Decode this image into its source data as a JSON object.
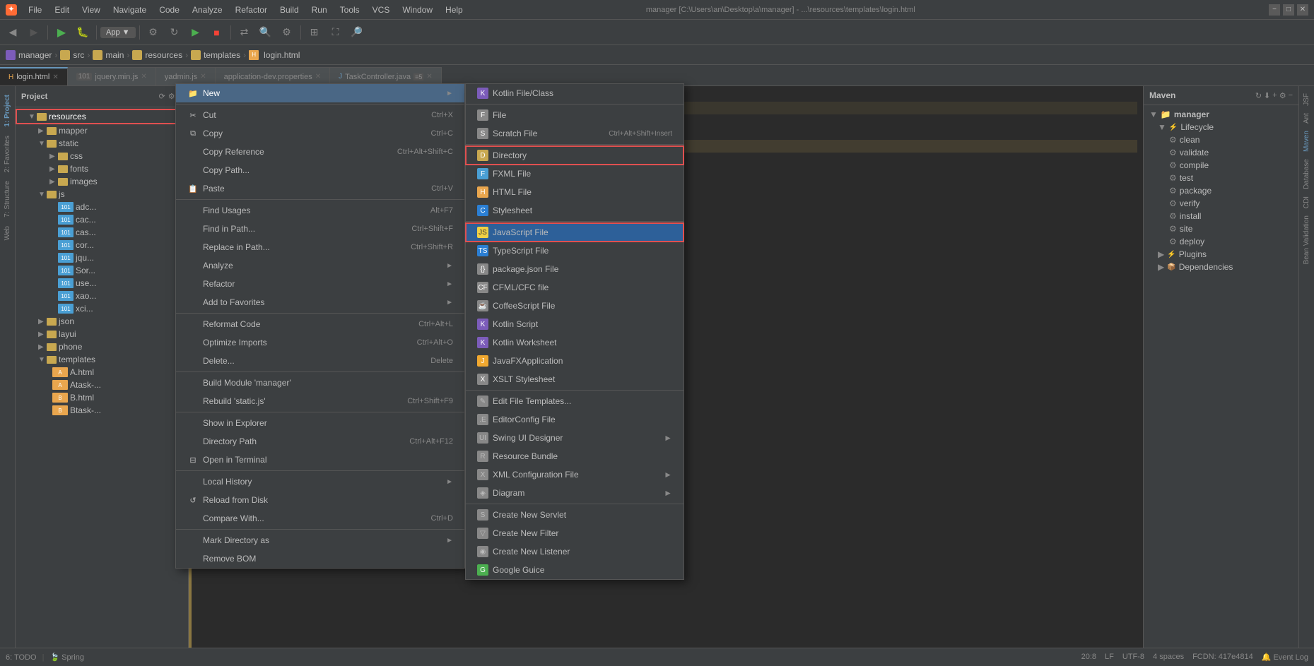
{
  "app": {
    "title": "manager",
    "path": "C:\\Users\\an\\Desktop\\a\\manager",
    "subtitle": "...\\resources\\templates\\login.html",
    "logo": "✦"
  },
  "menubar": {
    "items": [
      "File",
      "Edit",
      "View",
      "Navigate",
      "Code",
      "Analyze",
      "Refactor",
      "Build",
      "Run",
      "Tools",
      "VCS",
      "Window",
      "Help"
    ]
  },
  "breadcrumb": {
    "items": [
      "manager",
      "src",
      "main",
      "resources",
      "templates",
      "login.html"
    ]
  },
  "tabs": [
    {
      "label": "login.html",
      "active": true,
      "modified": false
    },
    {
      "label": "jquery.min.js",
      "active": false,
      "modified": false,
      "badge": "101"
    },
    {
      "label": "yadmin.js",
      "active": false,
      "modified": false
    },
    {
      "label": "application-dev.properties",
      "active": false,
      "modified": false
    },
    {
      "label": "TaskController.java",
      "active": false,
      "modified": false,
      "badge": "≡5"
    }
  ],
  "sidebar": {
    "title": "Project",
    "tree": [
      {
        "label": "resources",
        "type": "folder",
        "indent": 1,
        "highlighted": true,
        "open": true
      },
      {
        "label": "mapper",
        "type": "folder",
        "indent": 2
      },
      {
        "label": "static",
        "type": "folder",
        "indent": 2,
        "open": true
      },
      {
        "label": "css",
        "type": "folder",
        "indent": 3
      },
      {
        "label": "fonts",
        "type": "folder",
        "indent": 3
      },
      {
        "label": "images",
        "type": "folder",
        "indent": 3
      },
      {
        "label": "js",
        "type": "folder",
        "indent": 2,
        "open": true
      },
      {
        "label": "adc...",
        "type": "file",
        "ext": "js",
        "indent": 4
      },
      {
        "label": "cac...",
        "type": "file",
        "ext": "js",
        "indent": 4
      },
      {
        "label": "cas...",
        "type": "file",
        "ext": "js",
        "indent": 4
      },
      {
        "label": "cor...",
        "type": "file",
        "ext": "js",
        "indent": 4
      },
      {
        "label": "jqu...",
        "type": "file",
        "ext": "js",
        "indent": 4
      },
      {
        "label": "Sor...",
        "type": "file",
        "ext": "js",
        "indent": 4
      },
      {
        "label": "use...",
        "type": "file",
        "ext": "js",
        "indent": 4
      },
      {
        "label": "xao...",
        "type": "file",
        "ext": "js",
        "indent": 4
      },
      {
        "label": "xci...",
        "type": "file",
        "ext": "js",
        "indent": 4
      },
      {
        "label": "json",
        "type": "folder",
        "indent": 2
      },
      {
        "label": "layui",
        "type": "folder",
        "indent": 2
      },
      {
        "label": "phone",
        "type": "folder",
        "indent": 2
      },
      {
        "label": "templates",
        "type": "folder",
        "indent": 2,
        "open": true
      },
      {
        "label": "A.html",
        "type": "file",
        "ext": "html",
        "indent": 3
      },
      {
        "label": "Atask-...",
        "type": "file",
        "ext": "html",
        "indent": 3
      },
      {
        "label": "B.html",
        "type": "file",
        "ext": "html",
        "indent": 3
      },
      {
        "label": "Btask-...",
        "type": "file",
        "ext": "html",
        "indent": 3
      }
    ]
  },
  "context_menu": {
    "items": [
      {
        "label": "New",
        "shortcut": "",
        "arrow": "►",
        "highlighted": true
      },
      {
        "separator": true
      },
      {
        "label": "Cut",
        "shortcut": "Ctrl+X",
        "icon": "✂"
      },
      {
        "label": "Copy",
        "shortcut": "Ctrl+C",
        "icon": "⧉"
      },
      {
        "label": "Copy Reference",
        "shortcut": "Ctrl+Alt+Shift+C"
      },
      {
        "label": "Copy Path...",
        "shortcut": ""
      },
      {
        "label": "Paste",
        "shortcut": "Ctrl+V",
        "icon": "📋"
      },
      {
        "separator": true
      },
      {
        "label": "Find Usages",
        "shortcut": "Alt+F7"
      },
      {
        "label": "Find in Path...",
        "shortcut": "Ctrl+Shift+F"
      },
      {
        "label": "Replace in Path...",
        "shortcut": "Ctrl+Shift+R"
      },
      {
        "label": "Analyze",
        "arrow": "►"
      },
      {
        "label": "Refactor",
        "arrow": "►"
      },
      {
        "label": "Add to Favorites",
        "arrow": "►"
      },
      {
        "separator": true
      },
      {
        "label": "Reformat Code",
        "shortcut": "Ctrl+Alt+L"
      },
      {
        "label": "Optimize Imports",
        "shortcut": "Ctrl+Alt+O"
      },
      {
        "label": "Delete...",
        "shortcut": "Delete"
      },
      {
        "separator": true
      },
      {
        "label": "Build Module 'manager'"
      },
      {
        "label": "Rebuild 'static.js'",
        "shortcut": "Ctrl+Shift+F9"
      },
      {
        "separator": true
      },
      {
        "label": "Show in Explorer"
      },
      {
        "label": "Directory Path",
        "shortcut": "Ctrl+Alt+F12"
      },
      {
        "label": "Open in Terminal"
      },
      {
        "separator": true
      },
      {
        "label": "Local History",
        "arrow": "►"
      },
      {
        "label": "Reload from Disk",
        "icon": "↺"
      },
      {
        "label": "Compare With...",
        "shortcut": "Ctrl+D"
      },
      {
        "separator": true
      },
      {
        "label": "Mark Directory as",
        "arrow": "►"
      },
      {
        "label": "Remove BOM"
      }
    ]
  },
  "submenu_new": {
    "items": [
      {
        "label": "Kotlin File/Class"
      },
      {
        "separator": true
      },
      {
        "label": "File"
      },
      {
        "label": "Scratch File",
        "shortcut": "Ctrl+Alt+Shift+Insert"
      },
      {
        "separator": true
      },
      {
        "label": "Directory",
        "highlighted_box": true
      },
      {
        "label": "FXML File"
      },
      {
        "label": "HTML File"
      },
      {
        "label": "Stylesheet"
      },
      {
        "separator": true
      },
      {
        "label": "JavaScript File",
        "highlighted": true,
        "js_highlight": true
      },
      {
        "label": "TypeScript File"
      },
      {
        "label": "package.json File"
      },
      {
        "label": "CFML/CFC file"
      },
      {
        "label": "CoffeeScript File"
      },
      {
        "label": "Kotlin Script"
      },
      {
        "label": "Kotlin Worksheet"
      },
      {
        "label": "JavaFXApplication"
      },
      {
        "label": "XSLT Stylesheet"
      },
      {
        "separator": true
      },
      {
        "label": "Edit File Templates..."
      },
      {
        "label": "EditorConfig File"
      },
      {
        "label": "Swing UI Designer",
        "arrow": "►"
      },
      {
        "label": "Resource Bundle"
      },
      {
        "label": "XML Configuration File",
        "arrow": "►"
      },
      {
        "label": "Diagram",
        "arrow": "►"
      },
      {
        "separator": true
      },
      {
        "label": "Create New Servlet"
      },
      {
        "label": "Create New Filter"
      },
      {
        "label": "Create New Listener"
      },
      {
        "label": "Google Guice"
      }
    ]
  },
  "maven": {
    "title": "Maven",
    "manager_label": "manager",
    "lifecycle": {
      "label": "Lifecycle",
      "items": [
        "clean",
        "validate",
        "compile",
        "test",
        "package",
        "verify",
        "install",
        "site",
        "deploy"
      ]
    },
    "plugins_label": "Plugins",
    "dependencies_label": "Dependencies"
  },
  "status_bar": {
    "todo": "6: TODO",
    "spring": "Spring",
    "position": "20:8",
    "lf": "LF",
    "encoding": "UTF-8",
    "indent": "4 spaces",
    "git": "FCDN: 417e4814",
    "event_log": "Event Log"
  },
  "right_sidebar_tabs": [
    "JSF",
    "Ant",
    "Maven",
    "Database",
    "CDI",
    "Bean Validation"
  ],
  "left_edge_tabs": [
    "1: Project",
    "2: Favorites",
    "7: Structure",
    "Web"
  ]
}
